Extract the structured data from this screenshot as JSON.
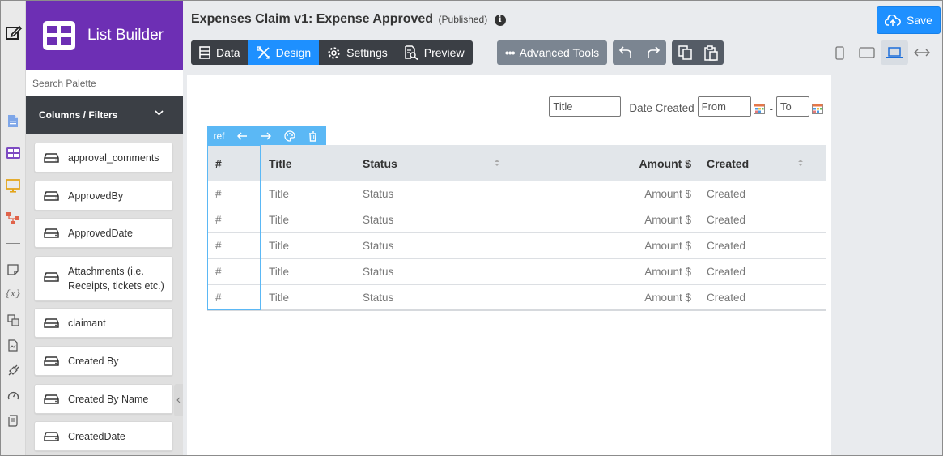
{
  "window": {
    "title": "Expenses Claim v1: Expense Approved",
    "status": "(Published)"
  },
  "brand": {
    "name": "List Builder"
  },
  "palette": {
    "search_placeholder": "Search Palette",
    "section_title": "Columns / Filters",
    "items": [
      "approval_comments",
      "ApprovedBy",
      "ApprovedDate",
      "Attachments (i.e. Receipts, tickets etc.)",
      "claimant",
      "Created By",
      "Created By Name",
      "CreatedDate"
    ]
  },
  "toolbar": {
    "save_label": "Save",
    "tabs": [
      "Data",
      "Design",
      "Settings",
      "Preview"
    ],
    "active_tab": "Design",
    "advanced_label": "Advanced Tools"
  },
  "filters": {
    "title_placeholder": "Title",
    "date_label": "Date Created",
    "from_placeholder": "From",
    "separator": "-",
    "to_placeholder": "To"
  },
  "column_toolbar": {
    "ref_label": "ref"
  },
  "table": {
    "headers": [
      "#",
      "Title",
      "Status",
      "Amount $",
      "Created"
    ],
    "rows": [
      [
        "#",
        "Title",
        "Status",
        "Amount $",
        "Created"
      ],
      [
        "#",
        "Title",
        "Status",
        "Amount $",
        "Created"
      ],
      [
        "#",
        "Title",
        "Status",
        "Amount $",
        "Created"
      ],
      [
        "#",
        "Title",
        "Status",
        "Amount $",
        "Created"
      ],
      [
        "#",
        "Title",
        "Status",
        "Amount $",
        "Created"
      ]
    ]
  },
  "colors": {
    "brand": "#6d2fb4",
    "accent": "#1e90ff",
    "dark": "#3b3f45",
    "selection": "#5bb8f5"
  }
}
